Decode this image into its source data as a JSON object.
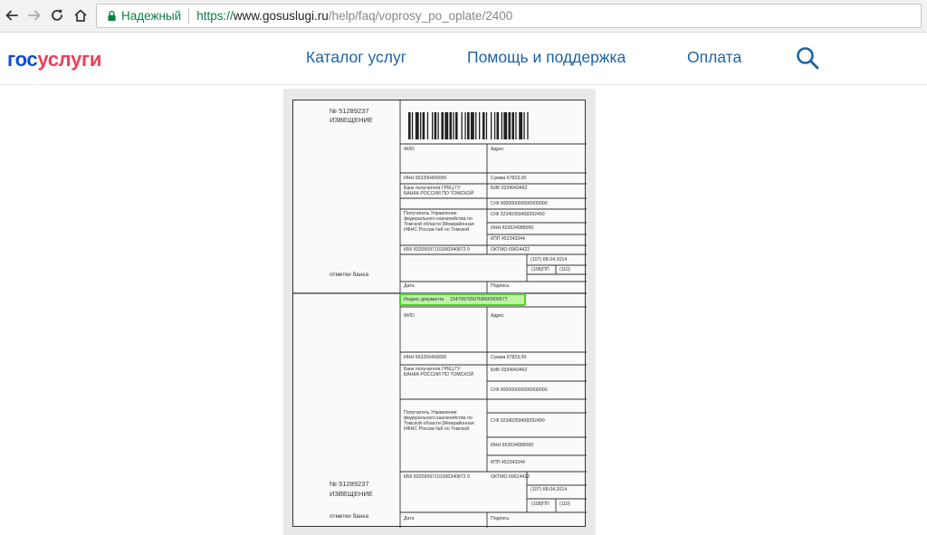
{
  "browser": {
    "secure_label": "Надежный",
    "url_scheme": "https://",
    "url_host": "www.gosuslugi.ru",
    "url_path": "/help/faq/voprosy_po_oplate/2400",
    "icons": [
      "back-arrow-icon",
      "forward-arrow-icon",
      "reload-icon",
      "home-icon",
      "lock-icon"
    ]
  },
  "header": {
    "logo_gos": "гос",
    "logo_uslugi": "услуги",
    "menu": [
      "Каталог услуг",
      "Помощь и поддержка",
      "Оплата"
    ],
    "search_icon": "search-icon",
    "link_color": "#1b63a6"
  },
  "receipt": {
    "top": {
      "number": "№ 51289237",
      "title": "ИЗВЕЩЕНИЕ",
      "bank_marks": "отметки банка",
      "fio": "ФИО",
      "address": "Адрес",
      "inn": "ИНН 563200400000",
      "sum": "Сумма 67823,00",
      "bank_line1": "Банк получателя ГРКЦ ГУ",
      "bank_line2": "БАНКА РОССИИ ПО ТОМСКОЙ",
      "bik": "БИК 0334943462",
      "account1": "С/Ф 000000000000000000",
      "recipient_lines": [
        "Получатель Управление",
        "федерального казначейства по",
        "Томской области (Межрайонная",
        "ИФНС России №6 по Томской"
      ],
      "account2": "С/Ф 32340359458392490",
      "recipient_inn": "ИНН 653634988000",
      "kpp": "КПП 452343344",
      "kbk": "КБК 83209597101000340872 9",
      "oktmo": "ОКТМО 69624422",
      "field107": "(107) КБ.04.2014",
      "field108": "(108)ПП",
      "field110": "(110)",
      "date": "Дата",
      "signature": "Подпись"
    },
    "index_label": "Индекс документа",
    "index_value": "1547067650768000000577",
    "bottom": {
      "number": "№ 51289237",
      "title": "ИЗВЕЩЕНИЕ",
      "bank_marks": "отметки банка",
      "fio": "ФИО",
      "address": "Адрес",
      "inn": "ИНН 563200400000",
      "sum": "Сумма 67823,00",
      "bank_line1": "Банк получателя ГРКЦ ГУ",
      "bank_line2": "БАНКА РОССИИ ПО ТОМСКОЙ",
      "bik": "БИК 0334943462",
      "account1": "С/Ф 000000000000000000",
      "recipient_lines": [
        "Получатель Управление",
        "федерального казначейства по",
        "Томской области (Межрайонная",
        "ИФНС России №6 по Томской"
      ],
      "account2": "С/Ф 32340359458392490",
      "recipient_inn": "ИНН 653634988000",
      "kpp": "КПП 452343344",
      "kbk": "КБК 83209597101000340872 9",
      "oktmo": "ОКТМО 69624422",
      "field107": "(107) КБ.04.2014",
      "field108": "(108)ПП",
      "field110": "(110)",
      "date": "Дата",
      "signature": "Подпись"
    },
    "highlight_color": "#4fd12a"
  }
}
